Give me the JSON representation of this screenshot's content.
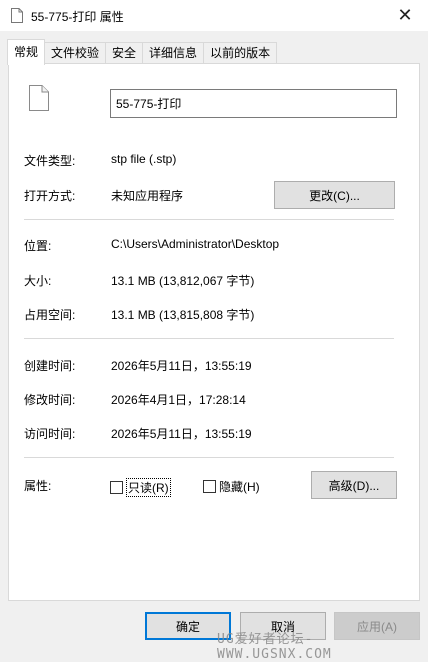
{
  "window": {
    "title": "55-775-打印 属性",
    "close_symbol": "✕"
  },
  "tabs": [
    "常规",
    "文件校验",
    "安全",
    "详细信息",
    "以前的版本"
  ],
  "general": {
    "file_name": "55-775-打印",
    "file_type_label": "文件类型:",
    "file_type_value": "stp file (.stp)",
    "opens_with_label": "打开方式:",
    "opens_with_value": "未知应用程序",
    "change_button": "更改(C)...",
    "location_label": "位置:",
    "location_value": "C:\\Users\\Administrator\\Desktop",
    "size_label": "大小:",
    "size_value": "13.1 MB (13,812,067 字节)",
    "size_on_disk_label": "占用空间:",
    "size_on_disk_value": "13.1 MB (13,815,808 字节)",
    "created_label": "创建时间:",
    "created_value": "2026年5月11日，13:55:19",
    "modified_label": "修改时间:",
    "modified_value": "2026年4月1日，17:28:14",
    "accessed_label": "访问时间:",
    "accessed_value": "2026年5月11日，13:55:19",
    "attributes_label": "属性:",
    "readonly_label": "只读(R)",
    "readonly_checked": false,
    "hidden_label": "隐藏(H)",
    "hidden_checked": false,
    "advanced_button": "高级(D)..."
  },
  "footer": {
    "ok_button": "确定",
    "cancel_button": "取消",
    "apply_button": "应用(A)"
  },
  "watermark": "UG爱好者论坛-WWW.UGSNX.COM",
  "icons": {
    "title_icon": "document-icon",
    "file_icon": "document-icon"
  }
}
